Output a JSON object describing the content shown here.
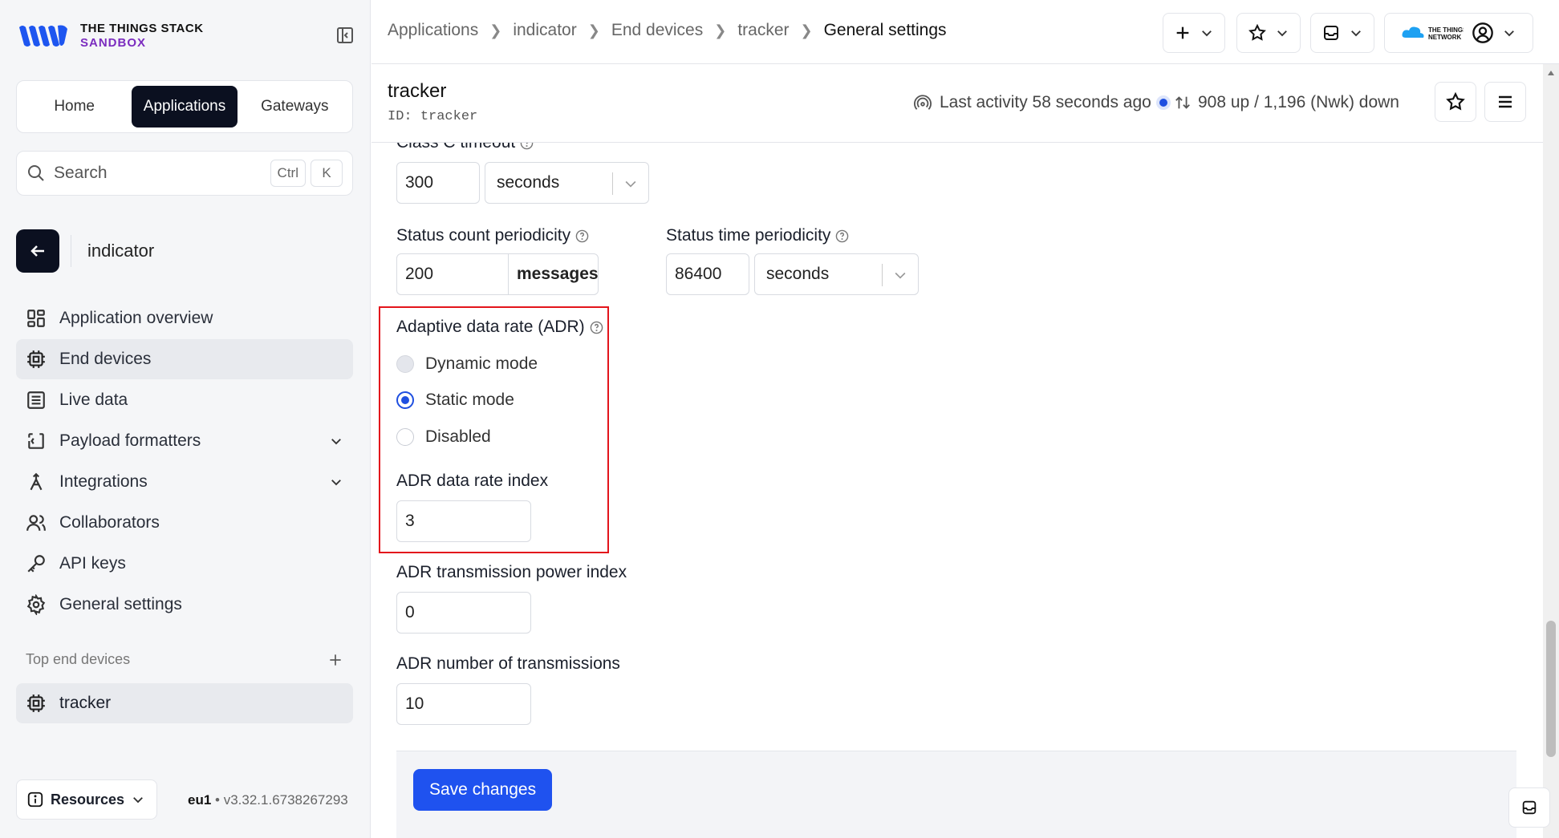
{
  "brand": {
    "line1": "THE THINGS STACK",
    "line2": "SANDBOX",
    "accent": "#7b2cbf"
  },
  "switcher": {
    "home": "Home",
    "applications": "Applications",
    "gateways": "Gateways"
  },
  "search": {
    "placeholder": "Search",
    "kbd1": "Ctrl",
    "kbd2": "K"
  },
  "application": {
    "name": "indicator"
  },
  "nav": [
    {
      "label": "Application overview",
      "icon": "grid-icon"
    },
    {
      "label": "End devices",
      "icon": "chip-icon",
      "active": true
    },
    {
      "label": "Live data",
      "icon": "list-icon"
    },
    {
      "label": "Payload formatters",
      "icon": "code-icon",
      "expandable": true
    },
    {
      "label": "Integrations",
      "icon": "integration-icon",
      "expandable": true
    },
    {
      "label": "Collaborators",
      "icon": "users-icon"
    },
    {
      "label": "API keys",
      "icon": "key-icon"
    },
    {
      "label": "General settings",
      "icon": "gear-icon"
    }
  ],
  "top_end_devices": {
    "title": "Top end devices",
    "items": [
      "tracker"
    ]
  },
  "footer_left": {
    "resources": "Resources",
    "region": "eu1",
    "version": "v3.32.1.6738267293"
  },
  "breadcrumbs": [
    "Applications",
    "indicator",
    "End devices",
    "tracker",
    "General settings"
  ],
  "device": {
    "name": "tracker",
    "id_label": "ID:",
    "id": "tracker",
    "last_activity": "Last activity 58 seconds ago",
    "traffic": "908 up / 1,196 (Nwk) down"
  },
  "form": {
    "class_c_timeout": {
      "label": "Class C timeout",
      "value": "300",
      "unit": "seconds"
    },
    "status_count": {
      "label": "Status count periodicity",
      "value": "200",
      "unit": "messages"
    },
    "status_time": {
      "label": "Status time periodicity",
      "value": "86400",
      "unit": "seconds"
    },
    "adr": {
      "label": "Adaptive data rate (ADR)",
      "options": [
        "Dynamic mode",
        "Static mode",
        "Disabled"
      ],
      "selected": "Static mode"
    },
    "adr_data_rate": {
      "label": "ADR data rate index",
      "value": "3"
    },
    "adr_tx_power": {
      "label": "ADR transmission power index",
      "value": "0"
    },
    "adr_nb_trans": {
      "label": "ADR number of transmissions",
      "value": "10"
    },
    "save_label": "Save changes"
  },
  "colors": {
    "primary": "#1f52ef",
    "dark": "#0b1020",
    "highlight": "#e3141b"
  }
}
